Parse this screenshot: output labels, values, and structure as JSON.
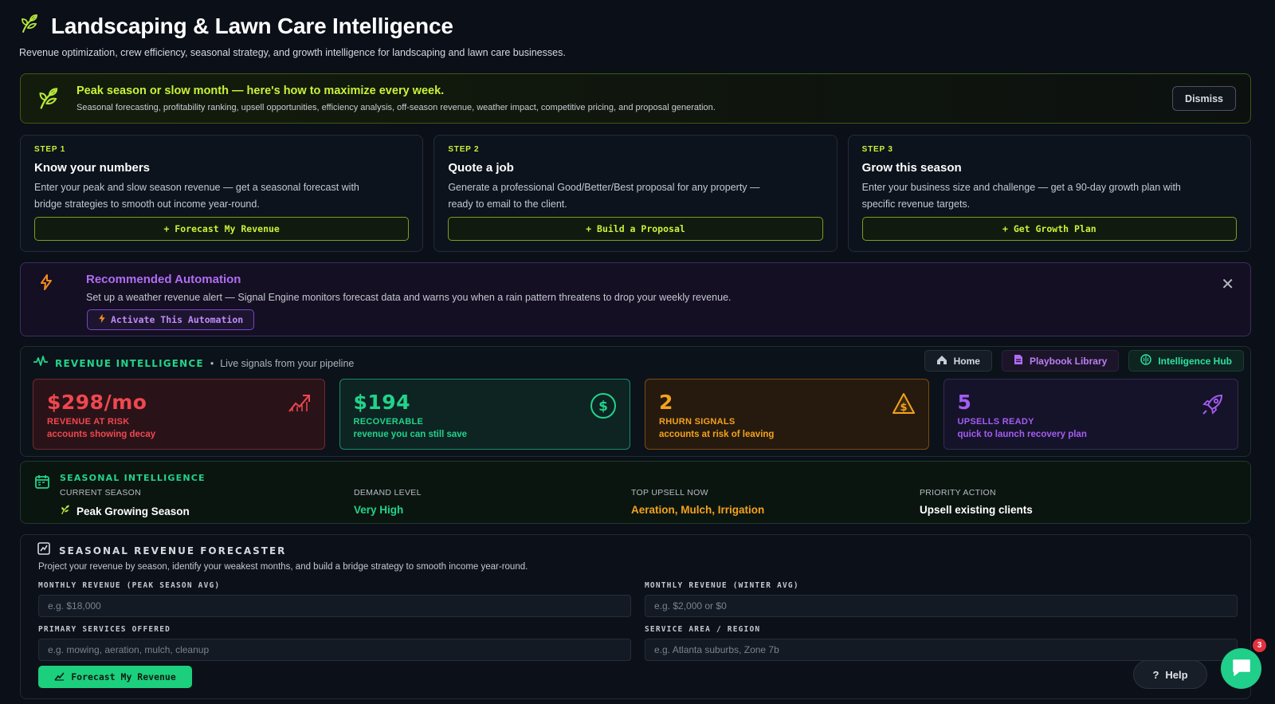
{
  "header": {
    "title": "Landscaping & Lawn Care Intelligence",
    "subtitle": "Revenue optimization, crew efficiency, seasonal strategy, and growth intelligence for landscaping and lawn care businesses.",
    "icon": "leaf-icon"
  },
  "banner": {
    "title": "Peak season or slow month — here's how to maximize every week.",
    "subtitle": "Seasonal forecasting, profitability ranking, upsell opportunities, efficiency analysis, off-season revenue, weather impact, competitive pricing, and proposal generation.",
    "dismiss_label": "Dismiss",
    "accent": "#c9f23a"
  },
  "steps": [
    {
      "label": "STEP 1",
      "title": "Know your numbers",
      "desc": "Enter your peak and slow season revenue — get a seasonal forecast with bridge strategies to smooth out income year-round.",
      "button": "+ Forecast My Revenue"
    },
    {
      "label": "STEP 2",
      "title": "Quote a job",
      "desc": "Generate a professional Good/Better/Best proposal for any property — ready to email to the client.",
      "button": "+ Build a Proposal"
    },
    {
      "label": "STEP 3",
      "title": "Grow this season",
      "desc": "Enter your business size and challenge — get a 90-day growth plan with specific revenue targets.",
      "button": "+ Get Growth Plan"
    }
  ],
  "automation": {
    "title": "Recommended Automation",
    "desc": "Set up a weather revenue alert — Signal Engine monitors forecast data and warns you when a rain pattern threatens to drop your weekly revenue.",
    "button": "Activate This Automation",
    "close_icon": "close-icon",
    "accent": "#b06cf5"
  },
  "revenue_intel": {
    "title": "REVENUE INTELLIGENCE",
    "subtitle": "Live signals from your pipeline",
    "nav": {
      "home": "Home",
      "playbook": "Playbook Library",
      "hub": "Intelligence Hub"
    },
    "metrics": [
      {
        "value": "$298/mo",
        "label": "REVENUE AT RISK",
        "sub": "accounts showing decay",
        "color": "#f0474f",
        "icon": "trending-up-icon"
      },
      {
        "value": "$194",
        "label": "RECOVERABLE",
        "sub": "revenue you can still save",
        "color": "#22d38a",
        "icon": "dollar-circle-icon"
      },
      {
        "value": "2",
        "label": "RHURN SIGNALS",
        "sub": "accounts at risk of leaving",
        "color": "#f4a21b",
        "icon": "warning-icon"
      },
      {
        "value": "5",
        "label": "UPSELLS READY",
        "sub": "quick to launch recovery plan",
        "color": "#a45cf2",
        "icon": "rocket-icon"
      }
    ]
  },
  "seasonal": {
    "title": "SEASONAL INTELLIGENCE",
    "current_season_label": "CURRENT SEASON",
    "current_season": "Peak Growing Season",
    "demand_label": "DEMAND LEVEL",
    "demand": "Very High",
    "upsell_label": "TOP UPSELL NOW",
    "upsell": "Aeration, Mulch, Irrigation",
    "priority_label": "PRIORITY ACTION",
    "priority": "Upsell existing clients"
  },
  "forecaster": {
    "title": "SEASONAL REVENUE FORECASTER",
    "desc": "Project your revenue by season, identify your weakest months, and build a bridge strategy to smooth income year-round.",
    "fields": {
      "peak_label": "MONTHLY REVENUE (PEAK SEASON AVG)",
      "peak_placeholder": "e.g. $18,000",
      "winter_label": "MONTHLY REVENUE (WINTER AVG)",
      "winter_placeholder": "e.g. $2,000 or $0",
      "services_label": "PRIMARY SERVICES OFFERED",
      "services_placeholder": "e.g. mowing, aeration, mulch, cleanup",
      "region_label": "SERVICE AREA / REGION",
      "region_placeholder": "e.g. Atlanta suburbs, Zone 7b"
    },
    "button": "Forecast My Revenue"
  },
  "floating": {
    "help": "Help",
    "chat_badge": "3"
  }
}
